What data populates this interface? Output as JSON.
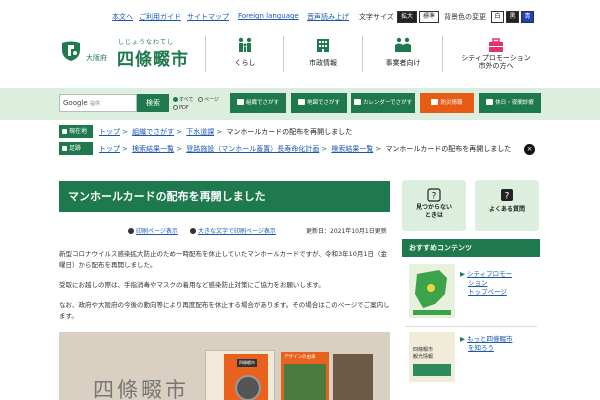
{
  "utility": {
    "links": [
      "本文へ",
      "ご利用ガイド",
      "サイトマップ",
      "Foreign language",
      "音声読み上げ"
    ],
    "text_size_label": "文字サイズ",
    "size_large": "拡大",
    "size_standard": "標準",
    "bg_color_label": "背景色の変更",
    "color_white": "白",
    "color_black": "黒",
    "color_blue": "青"
  },
  "header": {
    "prefecture": "大阪府",
    "city_ruby": "しじょうなわてし",
    "city_name": "四條畷市",
    "nav": [
      {
        "label": "くらし",
        "icon": "family-icon"
      },
      {
        "label": "市政情報",
        "icon": "city-hall-icon"
      },
      {
        "label": "事業者向け",
        "icon": "business-people-icon"
      },
      {
        "label": "シティプロモーション",
        "label2": "市外の方へ",
        "icon": "briefcase-icon"
      }
    ]
  },
  "search": {
    "brand": "Google",
    "placeholder": "提供",
    "button": "検索",
    "options": [
      "すべて",
      "ページ",
      "PDF"
    ],
    "quick": [
      {
        "label": "組織でさがす",
        "icon": "org-icon"
      },
      {
        "label": "地図でさがす",
        "icon": "map-icon"
      },
      {
        "label": "カレンダーでさがす",
        "icon": "calendar-icon"
      },
      {
        "label": "防災情報",
        "icon": "disaster-icon"
      },
      {
        "label": "休日・夜間診療",
        "icon": "medical-icon"
      }
    ]
  },
  "breadcrumbs": {
    "current_tag": "現在地",
    "current_links": [
      "トップ",
      "組織でさがす",
      "下水道課"
    ],
    "current_page": "マンホールカードの配布を再開しました",
    "history_tag": "足跡",
    "history_links": [
      "トップ",
      "検索結果一覧",
      "登路施設（マンホール蓋置）長寿命化計画",
      "検索結果一覧"
    ],
    "history_page": "マンホールカードの配布を再開しました"
  },
  "article": {
    "title": "マンホールカードの配布を再開しました",
    "print_link": "印刷ページ表示",
    "large_print_link": "大きな文字で印刷ページ表示",
    "updated": "更新日：2021年10月1日更新",
    "paragraphs": [
      "新型コロナウイルス感染拡大防止のため一時配布を休止していたマンホールカードですが、令和3年10月1日（金曜日）から配布を再開しました。",
      "受取にお越しの際は、手指消毒やマスクの着用など感染防止対策にご協力をお願いします。",
      "なお、政府や大阪府の今後の動向等により再度配布を休止する場合があります。その場合はこのページでご案内します。"
    ],
    "photo": {
      "city_text": "四條畷市",
      "card_title": "四條畷市",
      "card2_label": "デザインの由来"
    }
  },
  "sidebar": {
    "box1": {
      "line1": "見つからない",
      "line2": "ときは",
      "icon": "question-icon"
    },
    "box2": {
      "label": "よくある質問",
      "icon": "faq-icon"
    },
    "rec_title": "おすすめコンテンツ",
    "rec_items": [
      {
        "line1": "シティプロモー",
        "line2": "ション",
        "line3": "トップページ"
      },
      {
        "line1": "もっと四條畷市",
        "line2": "を知ろう"
      }
    ],
    "rec_thumb2_lines": [
      "四條畷市",
      "観光情報"
    ]
  },
  "colors": {
    "brand_green": "#1e7a4e",
    "light_green": "#dcefdf",
    "alert_orange": "#e85b14",
    "link_blue": "#1a56b3"
  }
}
